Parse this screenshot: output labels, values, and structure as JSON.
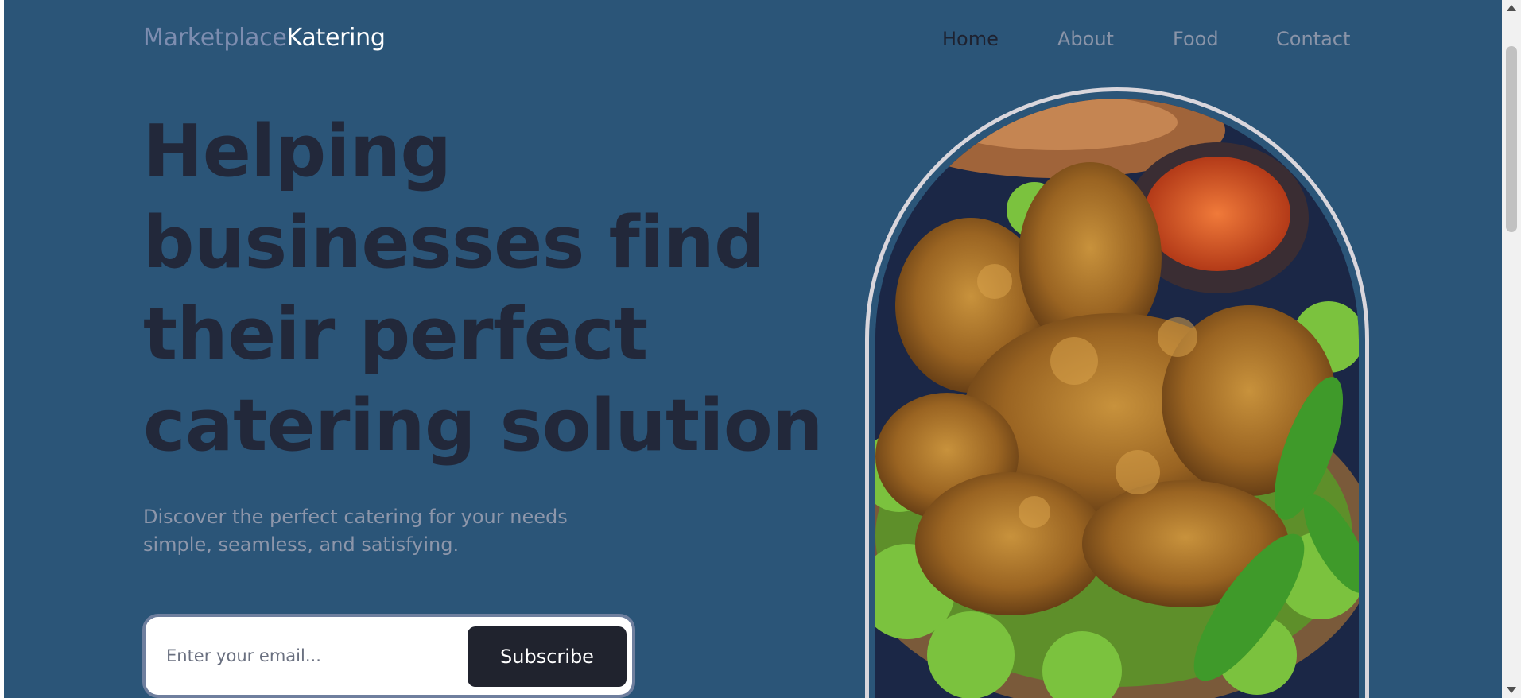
{
  "brand": {
    "part1": "Marketplace",
    "part2": "Katering"
  },
  "nav": {
    "items": [
      {
        "label": "Home"
      },
      {
        "label": "About"
      },
      {
        "label": "Food"
      },
      {
        "label": "Contact"
      }
    ]
  },
  "hero": {
    "title_lines": [
      "Helping",
      "businesses find",
      "their perfect",
      "catering solution"
    ],
    "subtitle_lines": [
      "Discover the perfect catering for your needs",
      "simple, seamless, and satisfying."
    ]
  },
  "subscribe": {
    "placeholder": "Enter your email...",
    "button_label": "Subscribe"
  },
  "colors": {
    "background": "#2b5578",
    "heading": "#22283a",
    "button": "#20232e",
    "logo_muted": "#7d8db0"
  }
}
